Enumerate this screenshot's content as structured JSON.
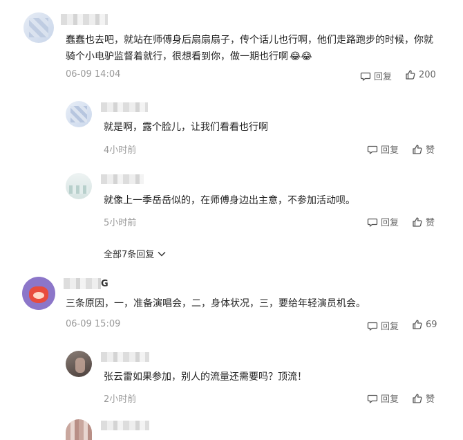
{
  "comments": [
    {
      "text_line1": "蠢蠢也去吧，就站在师傅身后扇扇扇子，传个话儿也行啊，他们走路跑步的时候，你就",
      "text_line2": "骑个小电驴监督着就行，很想看到你，做一期也行啊",
      "emoji": "😂",
      "time": "06-09 14:04",
      "reply_label": "回复",
      "like_count": "200",
      "replies": [
        {
          "name_tail": "",
          "text": "就是啊，露个脸儿，让我们看看也行啊",
          "time": "4小时前",
          "reply_label": "回复",
          "like_label": "赞"
        },
        {
          "name_tail": "",
          "text": "就像上一季岳岳似的，在师傅身边出主意，不参加活动呗。",
          "time": "5小时前",
          "reply_label": "回复",
          "like_label": "赞"
        }
      ],
      "expand_label": "全部7条回复"
    },
    {
      "name_tail": "G",
      "text": "三条原因，一，准备演唱会，二，身体状况，三，要给年轻演员机会。",
      "time": "06-09 15:09",
      "reply_label": "回复",
      "like_count": "69",
      "replies": [
        {
          "text": "张云雷如果参加，别人的流量还需要吗？顶流！",
          "time": "2小时前",
          "reply_label": "回复",
          "like_label": "赞"
        }
      ]
    }
  ],
  "icons": {
    "reply": "comment-bubble-icon",
    "like": "thumbs-up-icon",
    "expand": "chevron-down-icon"
  }
}
